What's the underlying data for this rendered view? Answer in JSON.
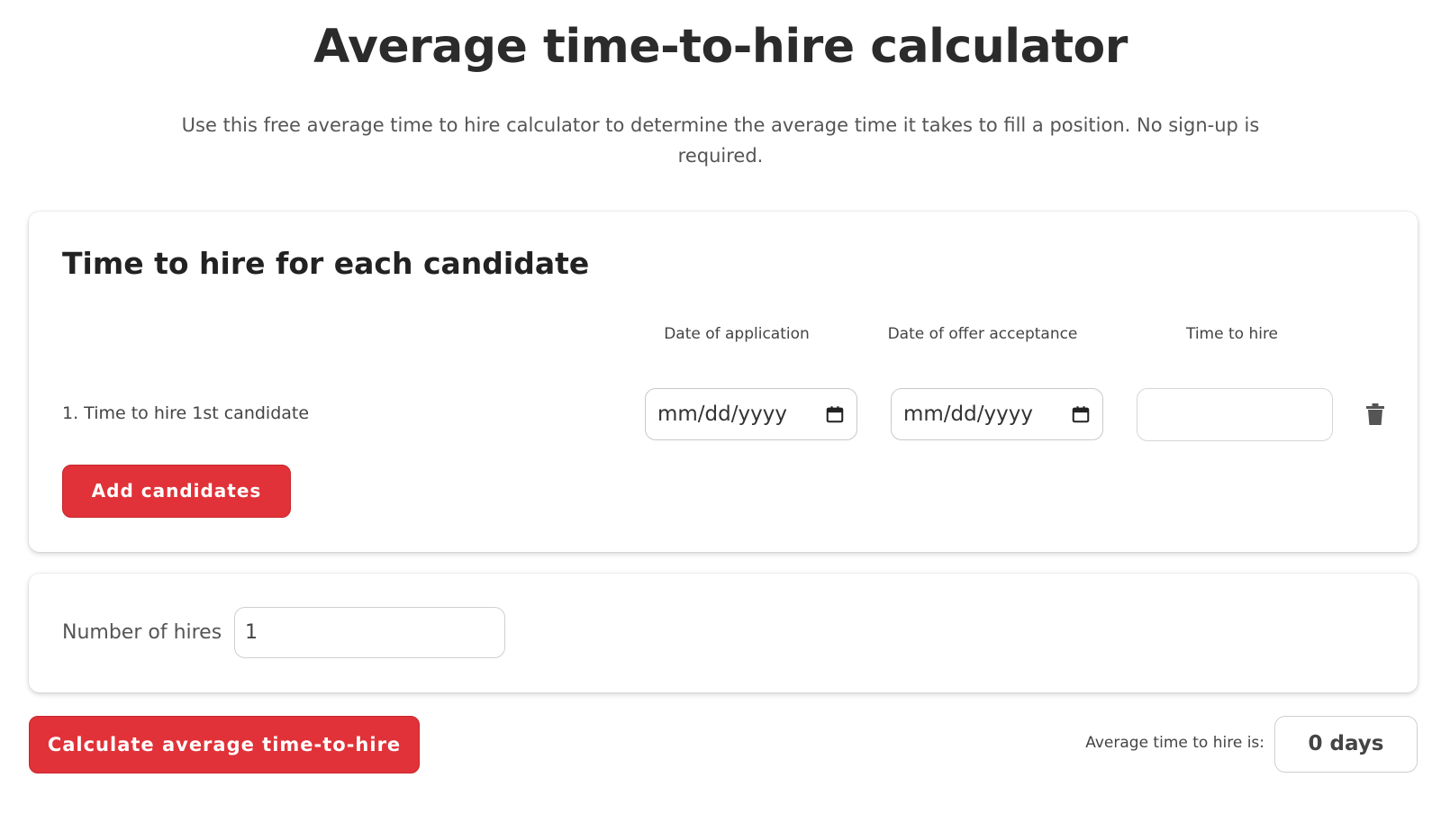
{
  "header": {
    "title": "Average time-to-hire calculator",
    "subtitle": "Use this free average time to hire calculator to determine the average time it takes to fill a position. No sign-up is required."
  },
  "candidates_card": {
    "title": "Time to hire for each candidate",
    "columns": {
      "application": "Date of application",
      "offer": "Date of offer acceptance",
      "time": "Time to hire"
    },
    "rows": [
      {
        "label": "1. Time to hire 1st candidate",
        "application_date": "mm/dd/yyyy",
        "offer_date": "mm/dd/yyyy",
        "time_to_hire": ""
      }
    ],
    "add_button": "Add candidates"
  },
  "hires_card": {
    "label": "Number of hires",
    "value": "1"
  },
  "footer": {
    "calculate_button": "Calculate average time-to-hire",
    "result_label": "Average time to hire is:",
    "result_value": "0 days"
  },
  "icons": {
    "calendar": "calendar-icon",
    "delete": "trash-icon"
  },
  "colors": {
    "accent": "#e03238",
    "text": "#2b2b2b",
    "muted": "#555555",
    "border": "#cfcfcf"
  }
}
